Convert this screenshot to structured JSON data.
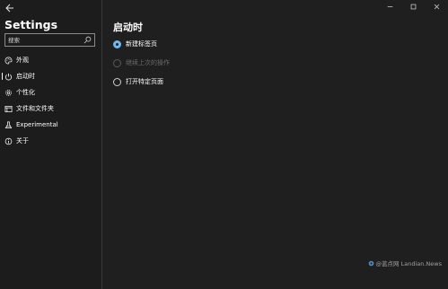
{
  "app": {
    "title": "Settings"
  },
  "search": {
    "placeholder": "搜索"
  },
  "sidebar": {
    "items": [
      {
        "label": "外观",
        "icon": "palette-icon",
        "selected": false
      },
      {
        "label": "启动时",
        "icon": "power-icon",
        "selected": true
      },
      {
        "label": "个性化",
        "icon": "gear-icon",
        "selected": false
      },
      {
        "label": "文件和文件夹",
        "icon": "folder-window-icon",
        "selected": false
      },
      {
        "label": "Experimental",
        "icon": "flask-icon",
        "selected": false
      },
      {
        "label": "关于",
        "icon": "info-icon",
        "selected": false
      }
    ]
  },
  "main": {
    "section_title": "启动时",
    "options": [
      {
        "label": "新建标签页",
        "checked": true,
        "disabled": false
      },
      {
        "label": "继续上次的操作",
        "checked": false,
        "disabled": true
      },
      {
        "label": "打开特定页面",
        "checked": false,
        "disabled": false
      }
    ]
  },
  "window_controls": {
    "minimize": "—",
    "maximize": "☐",
    "close": "✕"
  },
  "watermark": {
    "text": "@蓝点网 Landian.News"
  },
  "colors": {
    "accent": "#6cb8f6",
    "background": "#1f1f1f",
    "sidebar": "#1c1c1c"
  }
}
